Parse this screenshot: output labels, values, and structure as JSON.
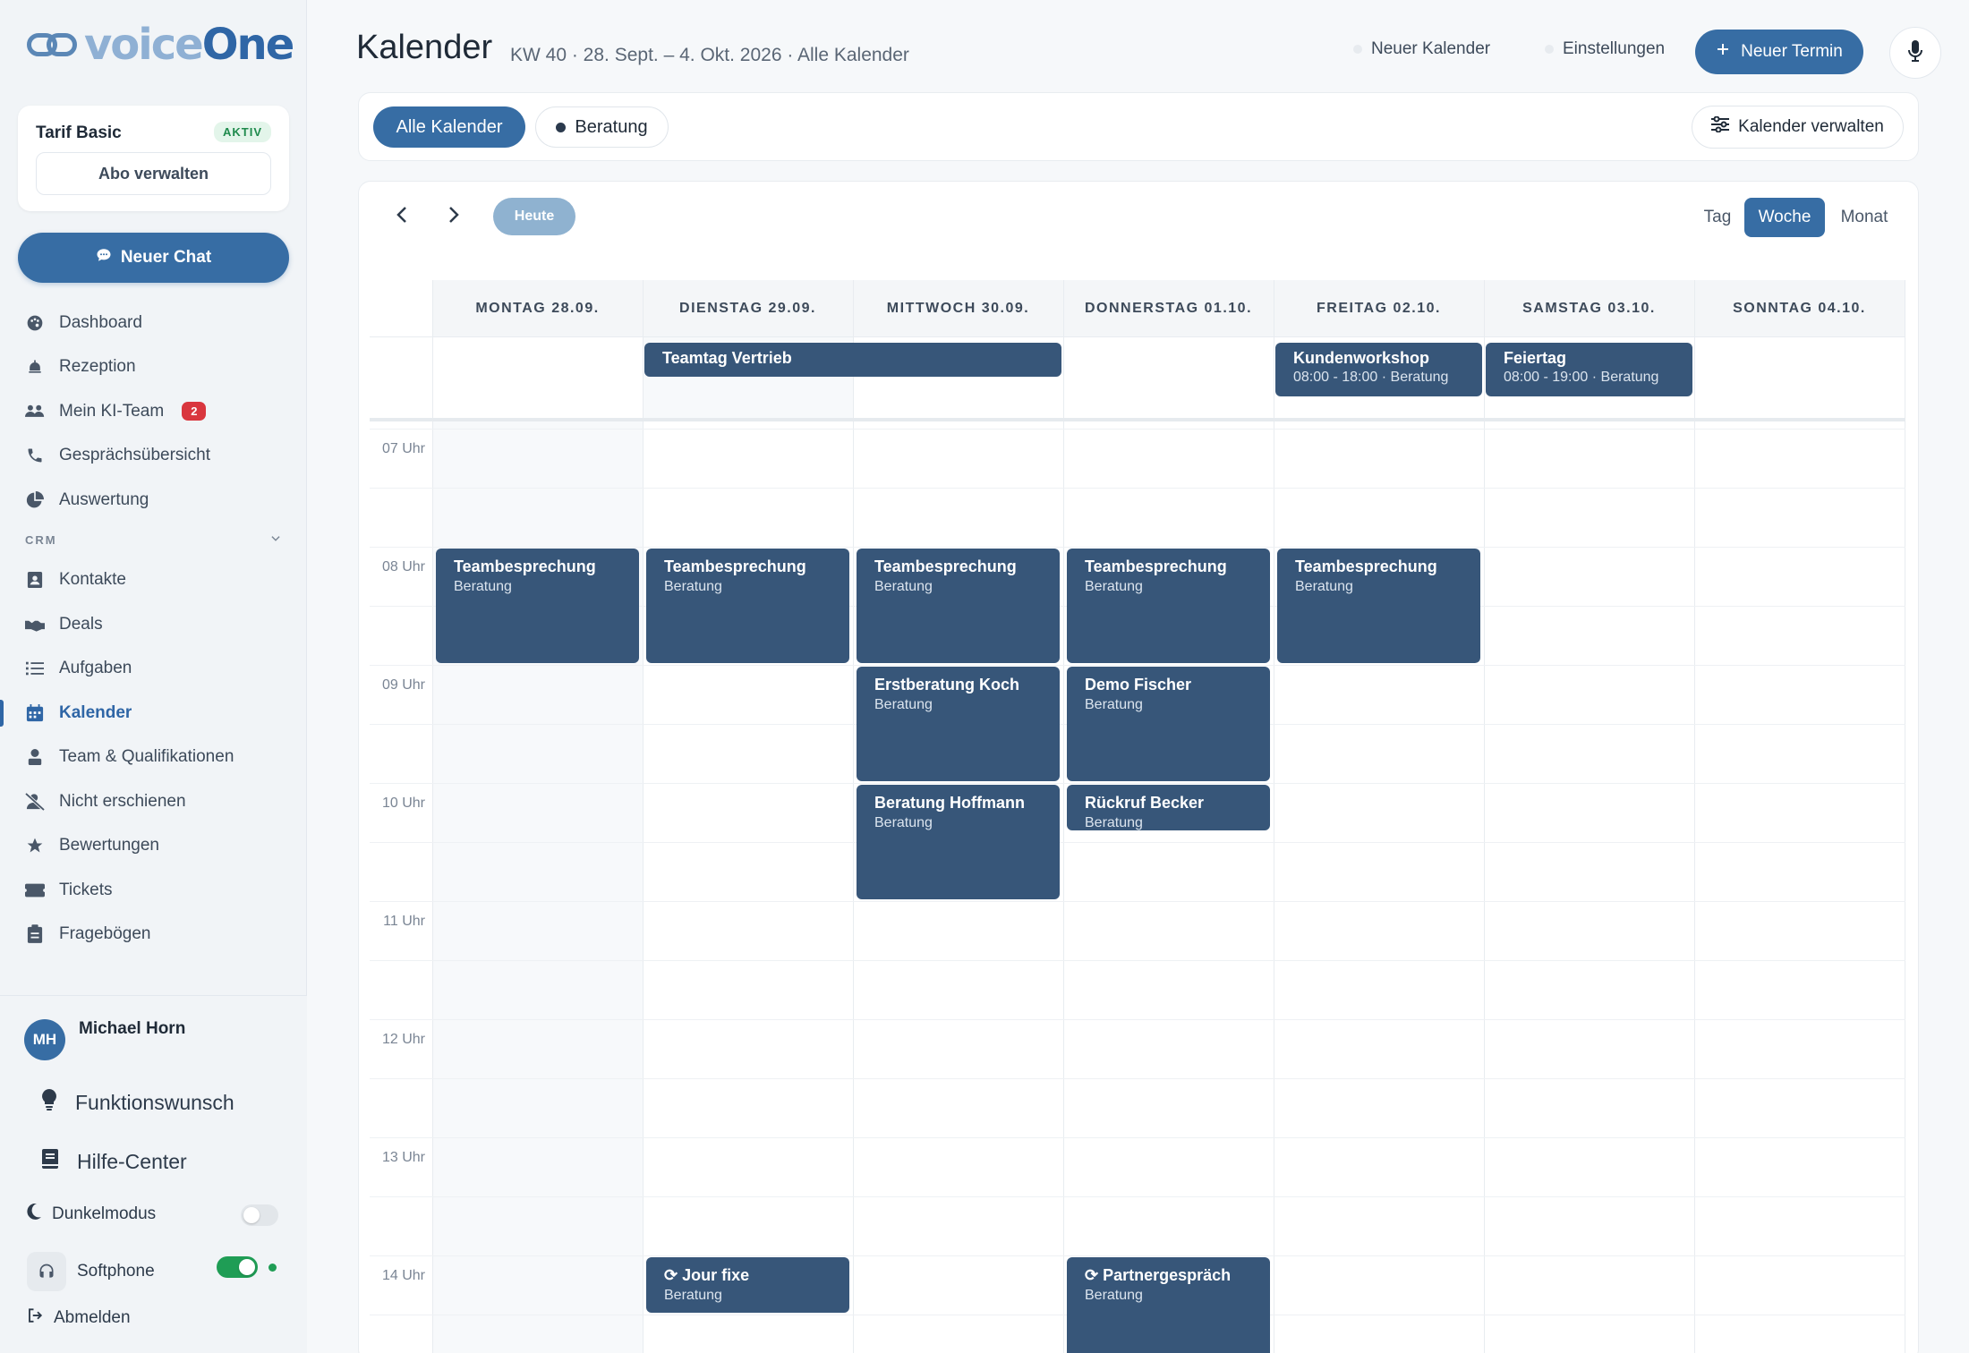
{
  "app": {
    "logo_left": "voice",
    "logo_right": "One"
  },
  "tarif": {
    "title": "Tarif Basic",
    "badge": "AKTIV",
    "manage": "Abo verwalten"
  },
  "new_chat": "Neuer Chat",
  "nav": {
    "items": [
      {
        "label": "Dashboard",
        "icon": "palette-icon"
      },
      {
        "label": "Rezeption",
        "icon": "bell-icon"
      },
      {
        "label": "Mein KI-Team",
        "icon": "users-icon",
        "badge": "2"
      },
      {
        "label": "Gesprächsübersicht",
        "icon": "phone-icon"
      },
      {
        "label": "Auswertung",
        "icon": "pie-chart-icon"
      }
    ],
    "crm_section": "CRM",
    "crm_items": [
      {
        "label": "Kontakte",
        "icon": "contact-icon"
      },
      {
        "label": "Deals",
        "icon": "handshake-icon"
      },
      {
        "label": "Aufgaben",
        "icon": "list-icon"
      },
      {
        "label": "Kalender",
        "icon": "calendar-icon",
        "active": true
      },
      {
        "label": "Team & Qualifikationen",
        "icon": "user-badge-icon"
      },
      {
        "label": "Nicht erschienen",
        "icon": "user-slash-icon"
      },
      {
        "label": "Bewertungen",
        "icon": "star-icon"
      },
      {
        "label": "Tickets",
        "icon": "ticket-icon"
      },
      {
        "label": "Fragebögen",
        "icon": "clipboard-icon"
      }
    ]
  },
  "user": {
    "initials": "MH",
    "name": "Michael Horn"
  },
  "footer": {
    "feature": "Funktionswunsch",
    "help": "Hilfe-Center",
    "dark_mode": "Dunkelmodus",
    "softphone": "Softphone",
    "logout": "Abmelden"
  },
  "header": {
    "title": "Kalender",
    "subtitle": "KW 40 · 28. Sept. – 4. Okt. 2026 · Alle Kalender",
    "new_calendar": "Neuer Kalender",
    "settings": "Einstellungen",
    "new_appointment": "Neuer Termin"
  },
  "filters": {
    "all": "Alle Kalender",
    "beratung": "Beratung",
    "manage": "Kalender verwalten"
  },
  "toolbar": {
    "today": "Heute",
    "views": [
      "Tag",
      "Woche",
      "Monat"
    ],
    "active_view": "Woche"
  },
  "days": [
    "MONTAG 28.09.",
    "DIENSTAG 29.09.",
    "MITTWOCH 30.09.",
    "DONNERSTAG 01.10.",
    "FREITAG 02.10.",
    "SAMSTAG 03.10.",
    "SONNTAG 04.10."
  ],
  "hours": [
    "07 Uhr",
    "08 Uhr",
    "09 Uhr",
    "10 Uhr",
    "11 Uhr",
    "12 Uhr",
    "13 Uhr",
    "14 Uhr"
  ],
  "allday_events": [
    {
      "title": "Teamtag Vertrieb",
      "sub": "",
      "day_start": 1,
      "day_end": 2
    },
    {
      "title": "Kundenworkshop",
      "sub": "08:00 - 18:00 · Beratung",
      "day_start": 4,
      "day_end": 4
    },
    {
      "title": "Feiertag",
      "sub": "08:00 - 19:00 · Beratung",
      "day_start": 5,
      "day_end": 5
    }
  ],
  "events": [
    {
      "title": "Teambesprechung",
      "sub": "Beratung",
      "day": 0,
      "start": 8.0,
      "end": 9.0
    },
    {
      "title": "Teambesprechung",
      "sub": "Beratung",
      "day": 1,
      "start": 8.0,
      "end": 9.0
    },
    {
      "title": "Teambesprechung",
      "sub": "Beratung",
      "day": 2,
      "start": 8.0,
      "end": 9.0
    },
    {
      "title": "Teambesprechung",
      "sub": "Beratung",
      "day": 3,
      "start": 8.0,
      "end": 9.0
    },
    {
      "title": "Teambesprechung",
      "sub": "Beratung",
      "day": 4,
      "start": 8.0,
      "end": 9.0
    },
    {
      "title": "Erstberatung Koch",
      "sub": "Beratung",
      "day": 2,
      "start": 9.0,
      "end": 10.0
    },
    {
      "title": "Demo Fischer",
      "sub": "Beratung",
      "day": 3,
      "start": 9.0,
      "end": 10.0
    },
    {
      "title": "Beratung Hoffmann",
      "sub": "Beratung",
      "day": 2,
      "start": 10.0,
      "end": 11.0
    },
    {
      "title": "Rückruf Becker",
      "sub": "Beratung",
      "day": 3,
      "start": 10.0,
      "end": 10.42
    },
    {
      "title": "⟳ Jour fixe",
      "sub": "Beratung",
      "day": 1,
      "start": 14.0,
      "end": 14.5
    },
    {
      "title": "⟳ Partnergespräch",
      "sub": "Beratung",
      "day": 3,
      "start": 14.0,
      "end": 15.0
    }
  ]
}
